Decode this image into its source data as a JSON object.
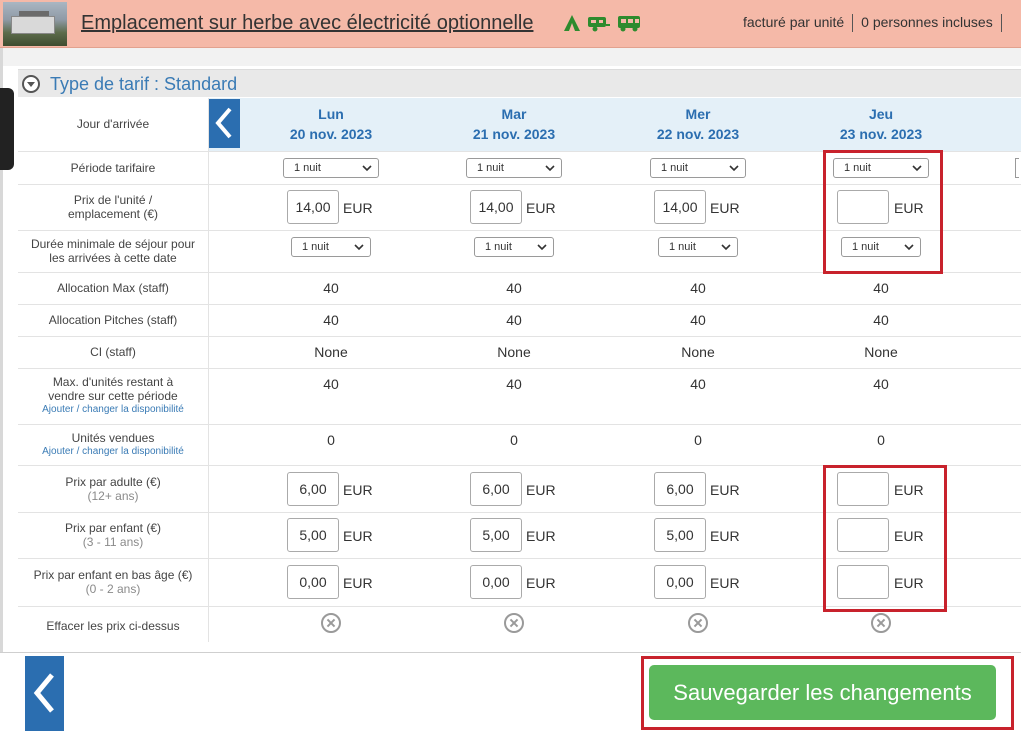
{
  "header": {
    "title": "Emplacement sur herbe avec électricité optionnelle",
    "icons": [
      "tent-icon",
      "caravan-icon",
      "motorhome-icon"
    ],
    "billing": "facturé par unité",
    "persons": "0 personnes incluses"
  },
  "panel": {
    "title": "Type de tarif : Standard"
  },
  "rows": {
    "arrival": "Jour d'arrivée",
    "period": "Période tarifaire",
    "unit_price": "Prix de l'unité / emplacement (€)",
    "min_stay": "Durée minimale de séjour pour les arrivées à cette date",
    "alloc_max": "Allocation Max (staff)",
    "alloc_pitches": "Allocation Pitches (staff)",
    "ci": "CI (staff)",
    "max_units": "Max. d'unités restant à vendre sur cette période",
    "max_units_link": "Ajouter / changer la disponibilité",
    "sold": "Unités vendues",
    "sold_link": "Ajouter / changer la disponibilité",
    "adult": "Prix par adulte (€)",
    "adult_sub": "(12+ ans)",
    "child": "Prix par enfant (€)",
    "child_sub": "(3 - 11 ans)",
    "infant": "Prix par enfant en bas âge (€)",
    "infant_sub": "(0 - 2 ans)",
    "clear": "Effacer les prix ci-dessus"
  },
  "currency": "EUR",
  "days": [
    {
      "day": "Lun",
      "date": "20 nov. 2023",
      "period": "1 nuit",
      "unit_price": "14,00",
      "min_stay": "1 nuit",
      "alloc_max": "40",
      "alloc_pitches": "40",
      "ci": "None",
      "max_units": "40",
      "sold": "0",
      "adult": "6,00",
      "child": "5,00",
      "infant": "0,00"
    },
    {
      "day": "Mar",
      "date": "21 nov. 2023",
      "period": "1 nuit",
      "unit_price": "14,00",
      "min_stay": "1 nuit",
      "alloc_max": "40",
      "alloc_pitches": "40",
      "ci": "None",
      "max_units": "40",
      "sold": "0",
      "adult": "6,00",
      "child": "5,00",
      "infant": "0,00"
    },
    {
      "day": "Mer",
      "date": "22 nov. 2023",
      "period": "1 nuit",
      "unit_price": "14,00",
      "min_stay": "1 nuit",
      "alloc_max": "40",
      "alloc_pitches": "40",
      "ci": "None",
      "max_units": "40",
      "sold": "0",
      "adult": "6,00",
      "child": "5,00",
      "infant": "0,00"
    },
    {
      "day": "Jeu",
      "date": "23 nov. 2023",
      "period": "1 nuit",
      "unit_price": "",
      "min_stay": "1 nuit",
      "alloc_max": "40",
      "alloc_pitches": "40",
      "ci": "None",
      "max_units": "40",
      "sold": "0",
      "adult": "",
      "child": "",
      "infant": ""
    }
  ],
  "footer": {
    "save_label": "Sauvegarder les changements"
  },
  "colors": {
    "header_bg": "#f5b9a8",
    "accent": "#2b6eb0",
    "save": "#5cb85c",
    "highlight": "#c8222c",
    "icon_green": "#2e8b2e"
  }
}
